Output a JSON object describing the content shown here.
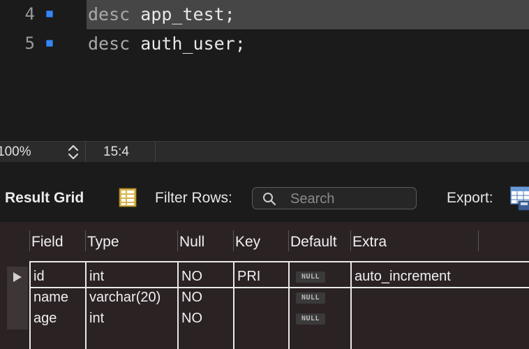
{
  "editor": {
    "lines": [
      {
        "number": "4",
        "keyword": "desc",
        "rest": " app_test;"
      },
      {
        "number": "5",
        "keyword": "desc",
        "rest": " auth_user;"
      }
    ]
  },
  "status": {
    "zoom": "100%",
    "cursor": "15:4"
  },
  "toolbar": {
    "result_grid_label": "Result Grid",
    "filter_rows_label": "Filter Rows:",
    "search_placeholder": "Search",
    "export_label": "Export:"
  },
  "grid": {
    "columns": [
      "Field",
      "Type",
      "Null",
      "Key",
      "Default",
      "Extra"
    ],
    "null_label": "NULL",
    "rows": [
      {
        "field": "id",
        "type": "int",
        "null": "NO",
        "key": "PRI",
        "extra": "auto_increment"
      },
      {
        "field": "name",
        "type": "varchar(20)",
        "null": "NO",
        "key": "",
        "extra": ""
      },
      {
        "field": "age",
        "type": "int",
        "null": "NO",
        "key": "",
        "extra": ""
      }
    ]
  },
  "colors": {
    "breakpoint": "#3a86f0",
    "highlight_line": "#464646",
    "grid_bg": "#2b2224"
  },
  "icons": {
    "stepper": "up-down-chevron-icon",
    "grid": "result-grid-icon",
    "search": "magnifier-icon",
    "export": "export-table-icon"
  }
}
